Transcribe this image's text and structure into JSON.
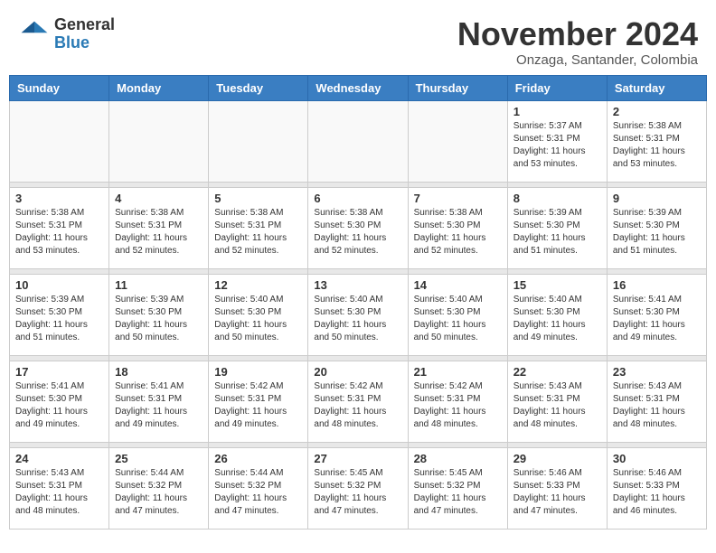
{
  "header": {
    "logo_general": "General",
    "logo_blue": "Blue",
    "month_title": "November 2024",
    "location": "Onzaga, Santander, Colombia"
  },
  "calendar": {
    "days_of_week": [
      "Sunday",
      "Monday",
      "Tuesday",
      "Wednesday",
      "Thursday",
      "Friday",
      "Saturday"
    ],
    "weeks": [
      [
        {
          "day": "",
          "info": ""
        },
        {
          "day": "",
          "info": ""
        },
        {
          "day": "",
          "info": ""
        },
        {
          "day": "",
          "info": ""
        },
        {
          "day": "",
          "info": ""
        },
        {
          "day": "1",
          "info": "Sunrise: 5:37 AM\nSunset: 5:31 PM\nDaylight: 11 hours and 53 minutes."
        },
        {
          "day": "2",
          "info": "Sunrise: 5:38 AM\nSunset: 5:31 PM\nDaylight: 11 hours and 53 minutes."
        }
      ],
      [
        {
          "day": "3",
          "info": "Sunrise: 5:38 AM\nSunset: 5:31 PM\nDaylight: 11 hours and 53 minutes."
        },
        {
          "day": "4",
          "info": "Sunrise: 5:38 AM\nSunset: 5:31 PM\nDaylight: 11 hours and 52 minutes."
        },
        {
          "day": "5",
          "info": "Sunrise: 5:38 AM\nSunset: 5:31 PM\nDaylight: 11 hours and 52 minutes."
        },
        {
          "day": "6",
          "info": "Sunrise: 5:38 AM\nSunset: 5:30 PM\nDaylight: 11 hours and 52 minutes."
        },
        {
          "day": "7",
          "info": "Sunrise: 5:38 AM\nSunset: 5:30 PM\nDaylight: 11 hours and 52 minutes."
        },
        {
          "day": "8",
          "info": "Sunrise: 5:39 AM\nSunset: 5:30 PM\nDaylight: 11 hours and 51 minutes."
        },
        {
          "day": "9",
          "info": "Sunrise: 5:39 AM\nSunset: 5:30 PM\nDaylight: 11 hours and 51 minutes."
        }
      ],
      [
        {
          "day": "10",
          "info": "Sunrise: 5:39 AM\nSunset: 5:30 PM\nDaylight: 11 hours and 51 minutes."
        },
        {
          "day": "11",
          "info": "Sunrise: 5:39 AM\nSunset: 5:30 PM\nDaylight: 11 hours and 50 minutes."
        },
        {
          "day": "12",
          "info": "Sunrise: 5:40 AM\nSunset: 5:30 PM\nDaylight: 11 hours and 50 minutes."
        },
        {
          "day": "13",
          "info": "Sunrise: 5:40 AM\nSunset: 5:30 PM\nDaylight: 11 hours and 50 minutes."
        },
        {
          "day": "14",
          "info": "Sunrise: 5:40 AM\nSunset: 5:30 PM\nDaylight: 11 hours and 50 minutes."
        },
        {
          "day": "15",
          "info": "Sunrise: 5:40 AM\nSunset: 5:30 PM\nDaylight: 11 hours and 49 minutes."
        },
        {
          "day": "16",
          "info": "Sunrise: 5:41 AM\nSunset: 5:30 PM\nDaylight: 11 hours and 49 minutes."
        }
      ],
      [
        {
          "day": "17",
          "info": "Sunrise: 5:41 AM\nSunset: 5:30 PM\nDaylight: 11 hours and 49 minutes."
        },
        {
          "day": "18",
          "info": "Sunrise: 5:41 AM\nSunset: 5:31 PM\nDaylight: 11 hours and 49 minutes."
        },
        {
          "day": "19",
          "info": "Sunrise: 5:42 AM\nSunset: 5:31 PM\nDaylight: 11 hours and 49 minutes."
        },
        {
          "day": "20",
          "info": "Sunrise: 5:42 AM\nSunset: 5:31 PM\nDaylight: 11 hours and 48 minutes."
        },
        {
          "day": "21",
          "info": "Sunrise: 5:42 AM\nSunset: 5:31 PM\nDaylight: 11 hours and 48 minutes."
        },
        {
          "day": "22",
          "info": "Sunrise: 5:43 AM\nSunset: 5:31 PM\nDaylight: 11 hours and 48 minutes."
        },
        {
          "day": "23",
          "info": "Sunrise: 5:43 AM\nSunset: 5:31 PM\nDaylight: 11 hours and 48 minutes."
        }
      ],
      [
        {
          "day": "24",
          "info": "Sunrise: 5:43 AM\nSunset: 5:31 PM\nDaylight: 11 hours and 48 minutes."
        },
        {
          "day": "25",
          "info": "Sunrise: 5:44 AM\nSunset: 5:32 PM\nDaylight: 11 hours and 47 minutes."
        },
        {
          "day": "26",
          "info": "Sunrise: 5:44 AM\nSunset: 5:32 PM\nDaylight: 11 hours and 47 minutes."
        },
        {
          "day": "27",
          "info": "Sunrise: 5:45 AM\nSunset: 5:32 PM\nDaylight: 11 hours and 47 minutes."
        },
        {
          "day": "28",
          "info": "Sunrise: 5:45 AM\nSunset: 5:32 PM\nDaylight: 11 hours and 47 minutes."
        },
        {
          "day": "29",
          "info": "Sunrise: 5:46 AM\nSunset: 5:33 PM\nDaylight: 11 hours and 47 minutes."
        },
        {
          "day": "30",
          "info": "Sunrise: 5:46 AM\nSunset: 5:33 PM\nDaylight: 11 hours and 46 minutes."
        }
      ]
    ]
  }
}
